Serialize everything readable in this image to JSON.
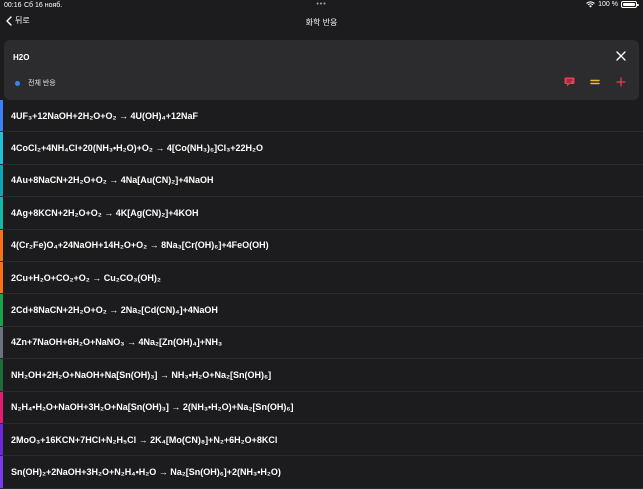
{
  "status": {
    "time": "00:16",
    "date": "Сб 16 нояб.",
    "battery": "100 %"
  },
  "nav": {
    "back_label": "뒤로",
    "title": "화학 반응"
  },
  "search": {
    "value": "H2O",
    "filter_label": "전체 반응"
  },
  "colors": {
    "accent_blue": "#3b82f6",
    "accent_red": "#ef3b4f",
    "accent_yellow": "#e6c229"
  },
  "reactions": [
    {
      "text": "4UF₃+12NaOH+2H₂O+O₂ → 4U(OH)₄+12NaF",
      "color": "#3b82f6"
    },
    {
      "text": "4CoCl₂+4NH₄Cl+20(NH₃•H₂O)+O₂ → 4[Co(NH₃)₆]Cl₃+22H₂O",
      "color": "#22c1d8"
    },
    {
      "text": "4Au+8NaCN+2H₂O+O₂ → 4Na[Au(CN)₂]+4NaOH",
      "color": "#0ea5b7"
    },
    {
      "text": "4Ag+8KCN+2H₂O+O₂ → 4K[Ag(CN)₂]+4KOH",
      "color": "#14b8a6"
    },
    {
      "text": "4(Cr₂Fe)O₄+24NaOH+14H₂O+O₂ → 8Na₃[Cr(OH)₆]+4FeO(OH)",
      "color": "#f97316"
    },
    {
      "text": "2Cu+H₂O+CO₂+O₂ → Cu₂CO₃(OH)₂",
      "color": "#f97316"
    },
    {
      "text": "2Cd+8NaCN+2H₂O+O₂ → 2Na₂[Cd(CN)₄]+4NaOH",
      "color": "#16a34a"
    },
    {
      "text": "4Zn+7NaOH+6H₂O+NaNO₃ → 4Na₂[Zn(OH)₄]+NH₃",
      "color": "#6b7280"
    },
    {
      "text": "NH₂OH+2H₂O+NaOH+Na[Sn(OH)₃] → NH₃•H₂O+Na₂[Sn(OH)₆]",
      "color": "#1e6b3a"
    },
    {
      "text": "N₂H₄•H₂O+NaOH+3H₂O+Na[Sn(OH)₃] → 2(NH₃•H₂O)+Na₂[Sn(OH)₆]",
      "color": "#e11d74"
    },
    {
      "text": "2MoO₃+16KCN+7HCl+N₂H₅Cl → 2K₄[Mo(CN)₈]+N₂+6H₂O+8KCl",
      "color": "#6d28d9"
    },
    {
      "text": "Sn(OH)₂+2NaOH+3H₂O+N₂H₄•H₂O → Na₂[Sn(OH)₆]+2(NH₃•H₂O)",
      "color": "#7c3aed"
    }
  ]
}
